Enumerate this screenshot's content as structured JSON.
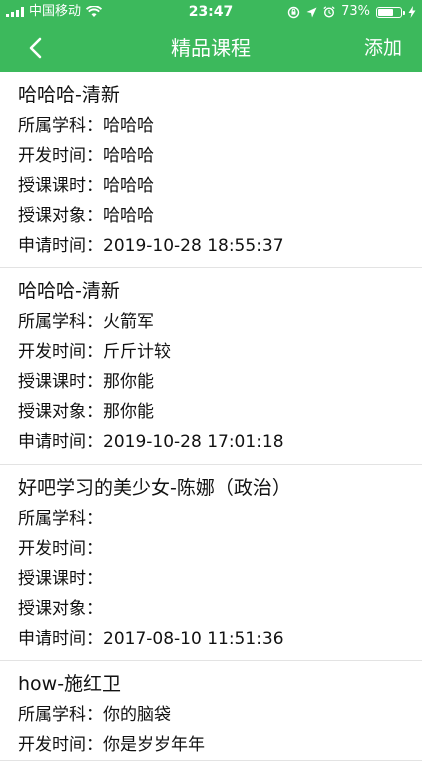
{
  "status_bar": {
    "carrier": "中国移动",
    "time": "23:47",
    "battery_text": "73%",
    "battery_level": 0.73,
    "icons": [
      "signal-icon",
      "wifi-icon",
      "rotation-lock-icon",
      "location-icon",
      "alarm-icon",
      "battery-icon",
      "charging-icon"
    ]
  },
  "nav": {
    "title": "精品课程",
    "add_label": "添加",
    "back_icon": "chevron-left-icon"
  },
  "labels": {
    "subject": "所属学科：",
    "dev_time": "开发时间：",
    "teach_hours": "授课课时：",
    "target": "授课对象：",
    "apply_time": "申请时间："
  },
  "courses": [
    {
      "title": "哈哈哈-清新",
      "subject": "哈哈哈",
      "dev_time": "哈哈哈",
      "teach_hours": "哈哈哈",
      "target": "哈哈哈",
      "apply_time": "2019-10-28 18:55:37"
    },
    {
      "title": "哈哈哈-清新",
      "subject": "火箭军",
      "dev_time": "斤斤计较",
      "teach_hours": "那你能",
      "target": "那你能",
      "apply_time": "2019-10-28 17:01:18"
    },
    {
      "title": "好吧学习的美少女-陈娜（政治）",
      "subject": "",
      "dev_time": "",
      "teach_hours": "",
      "target": "",
      "apply_time": "2017-08-10 11:51:36"
    },
    {
      "title": "how-施红卫",
      "subject": "你的脑袋",
      "dev_time": "你是岁岁年年"
    }
  ],
  "colors": {
    "accent": "#3cb95c"
  }
}
